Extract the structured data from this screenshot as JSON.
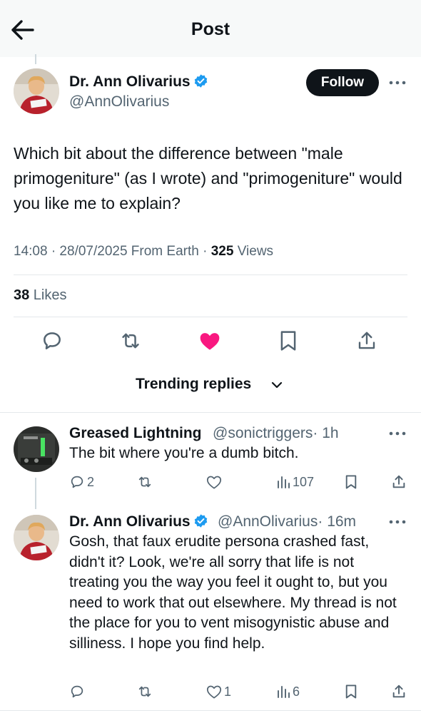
{
  "header": {
    "title": "Post"
  },
  "post": {
    "author_name": "Dr. Ann Olivarius",
    "author_handle": "@AnnOlivarius",
    "follow_label": "Follow",
    "text": "Which bit about the difference between \"male primogeniture\" (as I wrote) and \"primogeniture\" would you like me to explain?",
    "timestamp": "14:08 · 28/07/2025 From Earth · ",
    "views_count": "325",
    "views_label": " Views",
    "likes_count": "38",
    "likes_label": " Likes"
  },
  "trending_label": "Trending replies",
  "replies": [
    {
      "name": "Greased Lightning",
      "handle": "@sonictriggers",
      "time": "· 1h",
      "text": "The bit where you're a dumb bitch.",
      "reply_count": "2",
      "retweet_count": "",
      "like_count": "",
      "view_count": "107"
    },
    {
      "name": "Dr. Ann Olivarius",
      "handle": "@AnnOlivarius",
      "time": "· 16m",
      "text": "Gosh, that faux erudite persona crashed fast, didn't it? Look, we're all sorry that life is not treating you the way you feel it ought to, but you need to work that out elsewhere. My thread is not the place for you to vent misogynistic abuse and silliness. I hope you find help.",
      "reply_count": "",
      "retweet_count": "",
      "like_count": "1",
      "view_count": "6"
    }
  ],
  "colors": {
    "like_active": "#f91880",
    "verified": "#1d9bf0",
    "muted": "#536471"
  }
}
